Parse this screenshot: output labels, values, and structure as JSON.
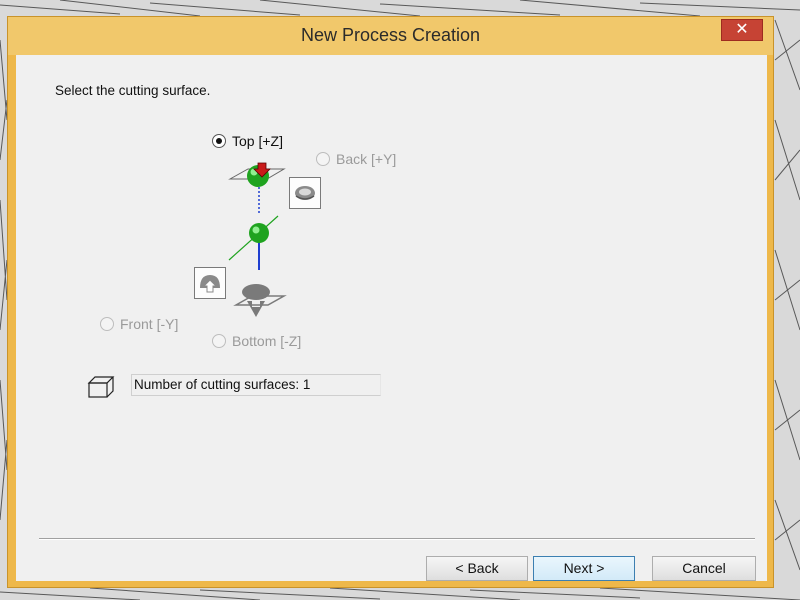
{
  "window": {
    "title": "New Process Creation",
    "close_glyph": "✕"
  },
  "prompt": "Select the cutting surface.",
  "options": {
    "top": {
      "label": "Top [+Z]",
      "checked": true,
      "enabled": true
    },
    "back": {
      "label": "Back [+Y]",
      "checked": false,
      "enabled": false
    },
    "front": {
      "label": "Front [-Y]",
      "checked": false,
      "enabled": false
    },
    "bottom": {
      "label": "Bottom [-Z]",
      "checked": false,
      "enabled": false
    }
  },
  "count_text": "Number of cutting surfaces: 1",
  "buttons": {
    "back": "< Back",
    "next": "Next >",
    "cancel": "Cancel"
  },
  "icons": {
    "close": "close-icon",
    "cube": "cube-icon",
    "top_arrow": "down-arrow-icon",
    "back_surface": "surface-back-icon",
    "front_surface": "surface-front-icon",
    "bottom_surface": "surface-bottom-icon"
  },
  "colors": {
    "title_bar": "#f1c86b",
    "frame": "#eeb84a",
    "close": "#c64334",
    "sphere": "#1fa31f",
    "arrow": "#c91a1a",
    "axis": "#1f3fd0"
  }
}
